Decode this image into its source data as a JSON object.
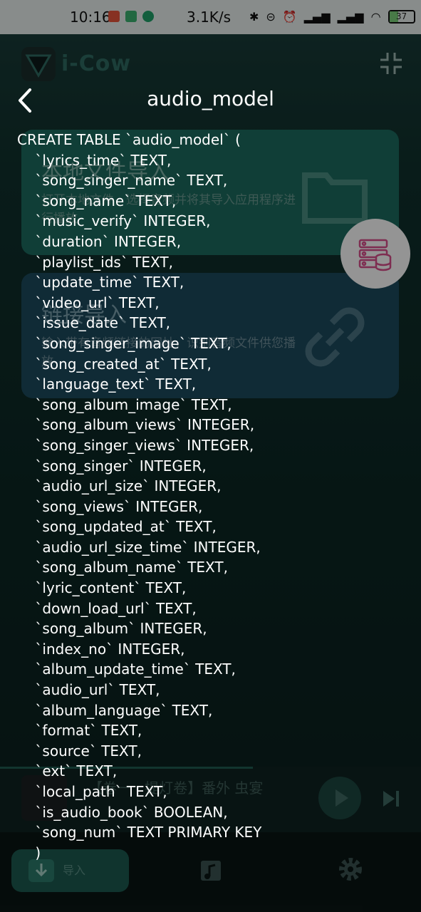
{
  "status_bar": {
    "time": "10:16",
    "net_speed": "3.1K/s",
    "battery": "37"
  },
  "app": {
    "name": "i-Cow",
    "cards": [
      {
        "title": "本地文件导入",
        "desc": "打开本地文件，选择音频并将其导入应用程序进行播放"
      },
      {
        "title": "链接导入",
        "desc": "输入带有音频链接的网址，识别音频文件供您播放"
      }
    ],
    "player": {
      "title": "【卷一 · 提灯卷】番外 虫宴"
    },
    "nav": {
      "import_label": "导入"
    }
  },
  "dialog": {
    "title": "audio_model",
    "sql_lines": [
      "CREATE TABLE `audio_model` (",
      "    `lyrics_time` TEXT,",
      "    `song_singer_name` TEXT,",
      "    `song_name` TEXT,",
      "    `music_verify` INTEGER,",
      "    `duration` INTEGER,",
      "    `playlist_ids` TEXT,",
      "    `update_time` TEXT,",
      "    `video_url` TEXT,",
      "    `issue_date` TEXT,",
      "    `song_singer_image` TEXT,",
      "    `song_created_at` TEXT,",
      "    `language_text` TEXT,",
      "    `song_album_image` TEXT,",
      "    `song_album_views` INTEGER,",
      "    `song_singer_views` INTEGER,",
      "    `song_singer` INTEGER,",
      "    `audio_url_size` INTEGER,",
      "    `song_views` INTEGER,",
      "    `song_updated_at` TEXT,",
      "    `audio_url_size_time` INTEGER,",
      "    `song_album_name` TEXT,",
      "    `lyric_content` TEXT,",
      "    `down_load_url` TEXT,",
      "    `song_album` INTEGER,",
      "    `index_no` INTEGER,",
      "    `album_update_time` TEXT,",
      "    `audio_url` TEXT,",
      "    `album_language` TEXT,",
      "    `format` TEXT,",
      "    `source` TEXT,",
      "    `ext` TEXT,",
      "    `local_path` TEXT,",
      "    `is_audio_book` BOOLEAN,",
      "    `song_num` TEXT PRIMARY KEY",
      "    )"
    ]
  },
  "colors": {
    "accent": "#1d6b5f",
    "card2": "#1c4b5d",
    "fab_icon": "#d94f8c"
  }
}
